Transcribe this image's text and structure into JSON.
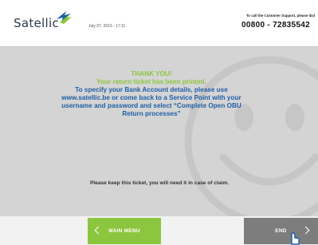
{
  "header": {
    "brand": "Satellic",
    "datetime": "July 07, 2016 - 17:11",
    "support_label": "To call the Customer Support, please dial",
    "support_phone": "00800 - 72835542",
    "logo_icon": "arrow-logo-icon",
    "brand_colors": {
      "green": "#8cc63f",
      "blue": "#1f5ea8"
    }
  },
  "message": {
    "title": "THANK YOU!",
    "printed": "Your return ticket has been printed.",
    "info_lines": [
      "To specify your Bank Account details, please use",
      "www.satellic.be or come back to a Service Point with your",
      "username and password and select “Complete Open OBU",
      "Return processes”"
    ],
    "keep_notice": "Please keep this ticket, you will need it in case of claim."
  },
  "buttons": {
    "main_menu": "MAIN MENU",
    "end": "END"
  },
  "icons": {
    "background": "smiley-face-icon",
    "main_menu_arrow": "chevron-left-icon",
    "end_arrow": "chevron-right-icon",
    "cursor": "hand-cursor-icon"
  }
}
